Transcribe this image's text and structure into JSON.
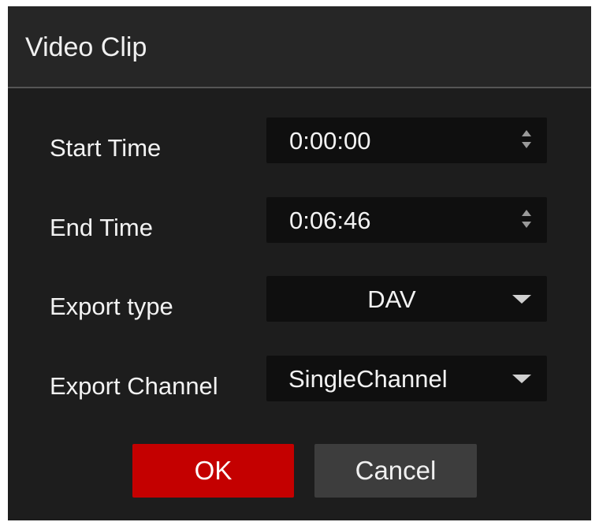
{
  "dialog": {
    "title": "Video Clip"
  },
  "fields": {
    "start_time": {
      "label": "Start Time",
      "value": "0:00:00"
    },
    "end_time": {
      "label": "End Time",
      "value": "0:06:46"
    },
    "export_type": {
      "label": "Export type",
      "value": "DAV"
    },
    "export_channel": {
      "label": "Export Channel",
      "value": "SingleChannel"
    }
  },
  "buttons": {
    "ok_label": "OK",
    "cancel_label": "Cancel"
  },
  "colors": {
    "ok_button": "#c40000",
    "dialog_background": "#1d1d1d",
    "field_background": "#0f0f0f"
  },
  "icons": {
    "spinner": "spinner-arrows-icon",
    "dropdown": "chevron-down-icon"
  }
}
